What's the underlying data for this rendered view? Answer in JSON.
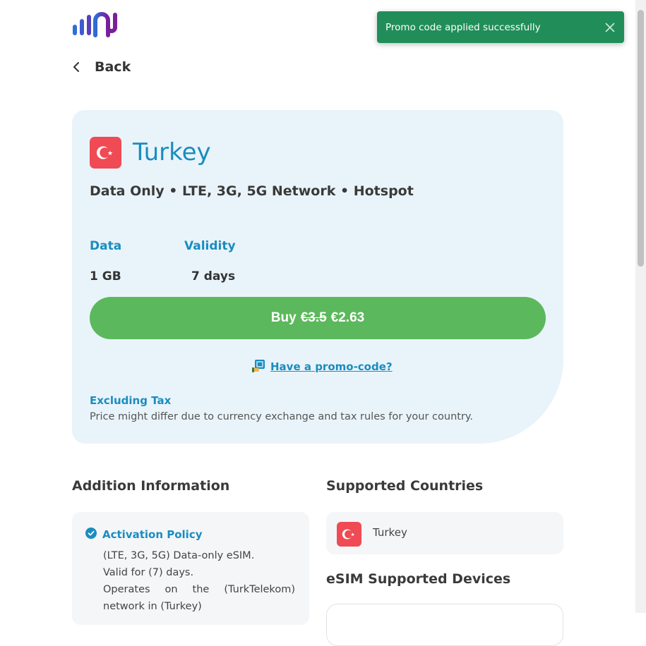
{
  "header": {
    "logo_icon": "brand-logo-icon",
    "back_label": "Back"
  },
  "toast": {
    "message": "Promo code applied successfully",
    "close_icon": "close-icon",
    "color": "#218e59"
  },
  "plan": {
    "country": "Turkey",
    "flag_icon": "turkey-flag-icon",
    "features": "Data Only • LTE, 3G, 5G Network • Hotspot",
    "data_label": "Data",
    "data_value": "1 GB",
    "validity_label": "Validity",
    "validity_value": "7 days",
    "buy_label": "Buy",
    "old_price": "€3.5",
    "new_price": "€2.63",
    "promo_label": "Have a promo-code?",
    "tax_title": "Excluding Tax",
    "tax_note": "Price might differ due to currency exchange and tax rules for your country."
  },
  "additional": {
    "title": "Addition Information",
    "policy_title": "Activation Policy",
    "lines": [
      "(LTE, 3G, 5G) Data-only eSIM.",
      "Valid for (7) days."
    ],
    "operates_words": [
      "Operates",
      "on",
      "the",
      "(TurkTelekom)"
    ],
    "last_line": "network in (Turkey)"
  },
  "supported": {
    "title": "Supported Countries",
    "countries": [
      {
        "name": "Turkey",
        "flag": "turkey-flag-icon"
      }
    ],
    "devices_title": "eSIM Supported Devices"
  },
  "colors": {
    "accent": "#1a8cc0",
    "buy": "#5cb85c",
    "card_bg": "#e9f4fa",
    "flag_red": "#f04a55"
  }
}
